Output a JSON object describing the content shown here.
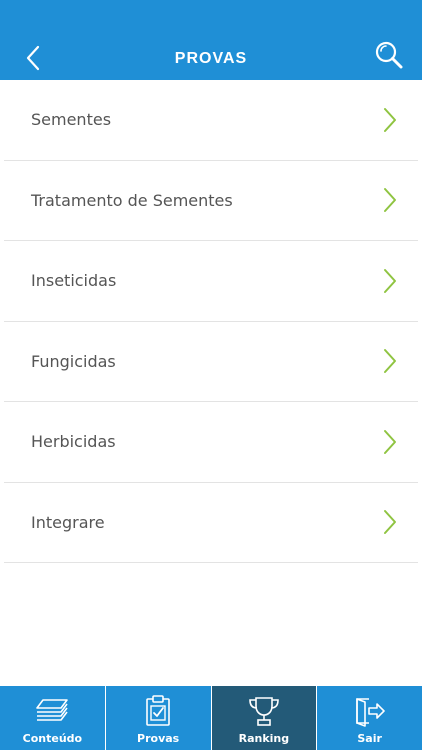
{
  "header": {
    "title": "PROVAS",
    "back_icon": "chevron-left-icon",
    "search_icon": "search-icon"
  },
  "list": {
    "items": [
      {
        "label": "Sementes"
      },
      {
        "label": "Tratamento de Sementes"
      },
      {
        "label": "Inseticidas"
      },
      {
        "label": "Fungicidas"
      },
      {
        "label": "Herbicidas"
      },
      {
        "label": "Integrare"
      }
    ]
  },
  "tabbar": {
    "tabs": [
      {
        "label": "Conteúdo",
        "icon": "layers-icon"
      },
      {
        "label": "Provas",
        "icon": "clipboard-check-icon"
      },
      {
        "label": "Ranking",
        "icon": "trophy-icon",
        "active": true
      },
      {
        "label": "Sair",
        "icon": "exit-door-icon"
      }
    ]
  },
  "colors": {
    "primary": "#1f8fd6",
    "active_tab": "#235a78",
    "chevron": "#8fc441",
    "text": "#555555"
  }
}
